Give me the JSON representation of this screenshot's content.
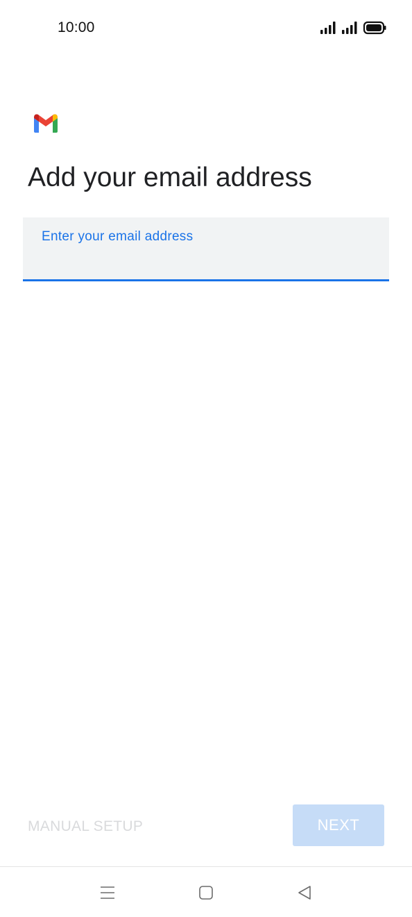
{
  "status_bar": {
    "time": "10:00",
    "icons": [
      "signal-icon",
      "signal-icon",
      "battery-icon"
    ]
  },
  "app": {
    "logo": "gmail-logo-icon",
    "title": "Add your email address"
  },
  "email_field": {
    "label": "Enter your email address",
    "value": ""
  },
  "actions": {
    "manual_setup_label": "MANUAL SETUP",
    "next_label": "NEXT"
  },
  "nav_bar": {
    "icons": [
      "menu-icon",
      "home-icon",
      "back-icon"
    ]
  },
  "colors": {
    "accent": "#1a73e8",
    "title_text": "#202124",
    "field_bg": "#f1f3f4",
    "next_disabled_bg": "#c6dcf7",
    "manual_disabled_text": "#d9dadc"
  }
}
